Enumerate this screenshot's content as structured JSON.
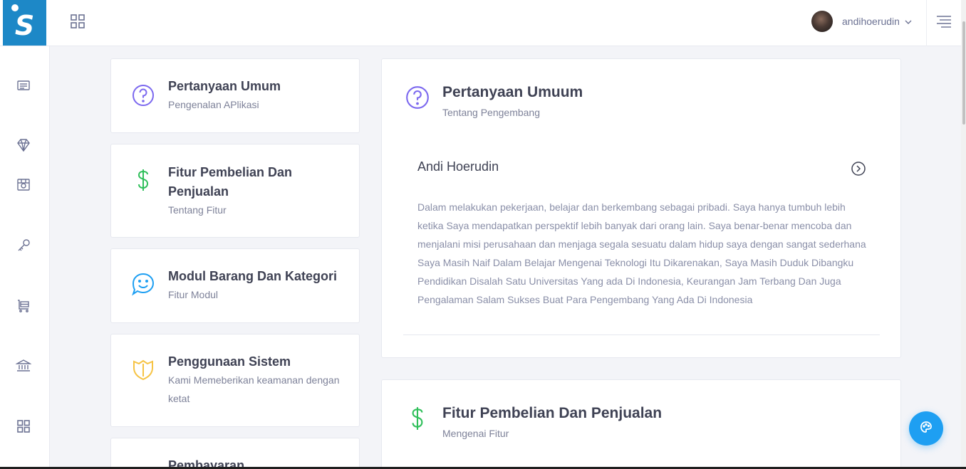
{
  "app": {
    "logo_letter": "S",
    "logo_color": "#1d88c7"
  },
  "header": {
    "username": "andihoerudin",
    "icons": {
      "apps": "grid-icon",
      "user_menu": "chevron-down-icon",
      "menu": "hamburger-menu-icon"
    }
  },
  "sidebar": {
    "items": [
      {
        "icon": "newspaper-icon"
      },
      {
        "icon": "diamond-icon"
      },
      {
        "icon": "package-icon"
      },
      {
        "icon": "key-icon"
      },
      {
        "icon": "cart-icon"
      },
      {
        "icon": "bank-icon"
      },
      {
        "icon": "grid-icon"
      }
    ]
  },
  "faq_categories": [
    {
      "title": "Pertanyaan Umum",
      "subtitle": "Pengenalan APlikasi",
      "icon": "question-circle-icon",
      "color": "#7c69ef"
    },
    {
      "title": "Fitur Pembelian Dan Penjualan",
      "subtitle": "Tentang Fitur",
      "icon": "dollar-icon",
      "color": "#2fbf5a"
    },
    {
      "title": "Modul Barang Dan Kategori",
      "subtitle": "Fitur Modul",
      "icon": "smile-chat-icon",
      "color": "#1e9ff2"
    },
    {
      "title": "Penggunaan Sistem",
      "subtitle": "Kami Memeberikan keamanan dengan ketat",
      "icon": "shield-icon",
      "color": "#f6c343"
    },
    {
      "title": "Pembayaran",
      "subtitle": "",
      "icon": "payment-icon",
      "color": "#f64e60"
    }
  ],
  "sections": [
    {
      "title": "Pertanyaan Umuum",
      "subtitle": "Tentang Pengembang",
      "icon": "question-circle-icon",
      "accordion": {
        "title": "Andi Hoerudin",
        "body": "Dalam melakukan pekerjaan, belajar dan berkembang sebagai pribadi. Saya hanya tumbuh lebih ketika Saya mendapatkan perspektif lebih banyak dari orang lain. Saya benar-benar mencoba dan menjalani misi perusahaan dan menjaga segala sesuatu dalam hidup saya dengan sangat sederhana Saya Masih Naif Dalam Belajar Mengenai Teknologi Itu Dikarenakan, Saya Masih Duduk Dibangku Pendidikan Disalah Satu Universitas Yang ada Di Indonesia, Keurangan Jam Terbang Dan Juga Pengalaman Salam Sukses Buat Para Pengembang Yang Ada Di Indonesia"
      }
    },
    {
      "title": "Fitur Pembelian Dan Penjualan",
      "subtitle": "Mengenai Fitur",
      "icon": "dollar-icon"
    }
  ],
  "fab": {
    "icon": "palette-icon",
    "color": "#1e9ff2"
  }
}
